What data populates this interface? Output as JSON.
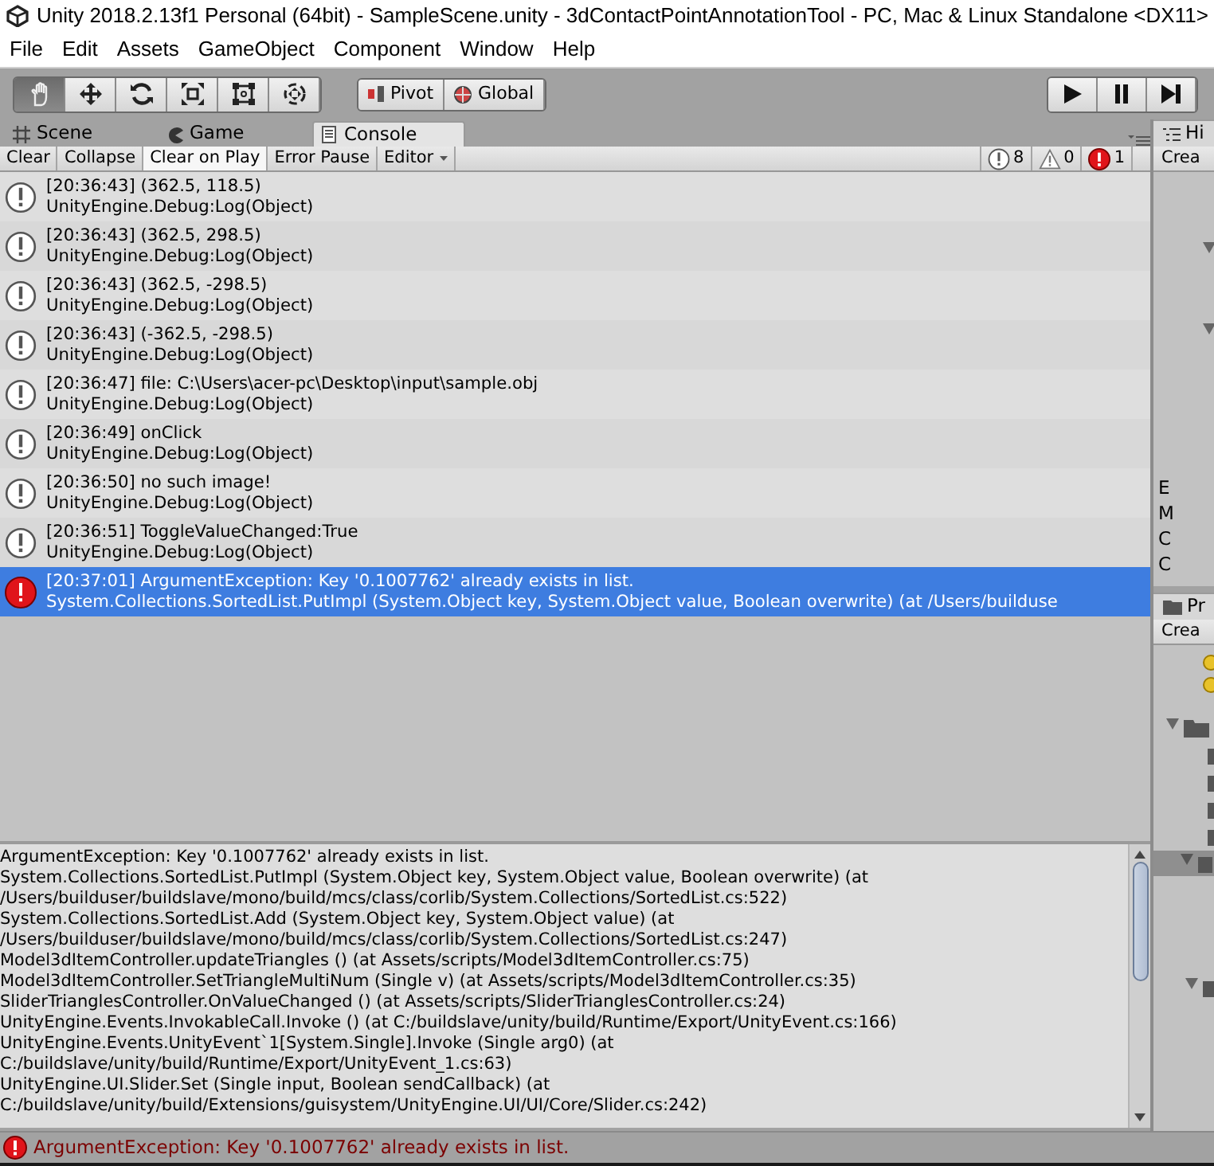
{
  "window": {
    "title": "Unity 2018.2.13f1 Personal (64bit) - SampleScene.unity - 3dContactPointAnnotationTool - PC, Mac & Linux Standalone <DX11>"
  },
  "menu": [
    "File",
    "Edit",
    "Assets",
    "GameObject",
    "Component",
    "Window",
    "Help"
  ],
  "tools": [
    {
      "kind": "hand",
      "selected": true
    },
    {
      "kind": "move",
      "selected": false
    },
    {
      "kind": "rotate",
      "selected": false
    },
    {
      "kind": "scale",
      "selected": false
    },
    {
      "kind": "rect",
      "selected": false
    },
    {
      "kind": "transform",
      "selected": false
    }
  ],
  "handle_buttons": [
    {
      "kind": "pivot",
      "label": "Pivot"
    },
    {
      "kind": "global",
      "label": "Global"
    }
  ],
  "playback": [
    {
      "kind": "play"
    },
    {
      "kind": "pause"
    },
    {
      "kind": "step"
    }
  ],
  "tabs": [
    {
      "kind": "scene",
      "label": "Scene",
      "selected": false
    },
    {
      "kind": "game",
      "label": "Game",
      "selected": false
    },
    {
      "kind": "console",
      "label": "Console",
      "selected": true
    }
  ],
  "console_toolbar": {
    "buttons": [
      {
        "label": "Clear",
        "on": false
      },
      {
        "label": "Collapse",
        "on": false
      },
      {
        "label": "Clear on Play",
        "on": true
      },
      {
        "label": "Error Pause",
        "on": false
      }
    ],
    "dropdown": "Editor",
    "counts": [
      {
        "kind": "info",
        "count": "8"
      },
      {
        "kind": "warning",
        "count": "0"
      },
      {
        "kind": "error",
        "count": "1"
      }
    ]
  },
  "logs": [
    {
      "kind": "info",
      "message": "[20:36:43] (362.5, 118.5)",
      "source": "UnityEngine.Debug:Log(Object)",
      "selected": false
    },
    {
      "kind": "info",
      "message": "[20:36:43] (362.5, 298.5)",
      "source": "UnityEngine.Debug:Log(Object)",
      "selected": false
    },
    {
      "kind": "info",
      "message": "[20:36:43] (362.5, -298.5)",
      "source": "UnityEngine.Debug:Log(Object)",
      "selected": false
    },
    {
      "kind": "info",
      "message": "[20:36:43] (-362.5, -298.5)",
      "source": "UnityEngine.Debug:Log(Object)",
      "selected": false
    },
    {
      "kind": "info",
      "message": "[20:36:47] file: C:\\Users\\acer-pc\\Desktop\\input\\sample.obj",
      "source": "UnityEngine.Debug:Log(Object)",
      "selected": false
    },
    {
      "kind": "info",
      "message": "[20:36:49] onClick",
      "source": "UnityEngine.Debug:Log(Object)",
      "selected": false
    },
    {
      "kind": "info",
      "message": "[20:36:50] no such image!",
      "source": "UnityEngine.Debug:Log(Object)",
      "selected": false
    },
    {
      "kind": "info",
      "message": "[20:36:51] ToggleValueChanged:True",
      "source": "UnityEngine.Debug:Log(Object)",
      "selected": false
    },
    {
      "kind": "error",
      "message": "[20:37:01] ArgumentException: Key '0.1007762' already exists in list.",
      "source": "System.Collections.SortedList.PutImpl (System.Object key, System.Object value, Boolean overwrite) (at /Users/builduse",
      "selected": true
    }
  ],
  "detail": [
    "ArgumentException: Key '0.1007762' already exists in list.",
    "System.Collections.SortedList.PutImpl (System.Object key, System.Object value, Boolean overwrite) (at",
    "/Users/builduser/buildslave/mono/build/mcs/class/corlib/System.Collections/SortedList.cs:522)",
    "System.Collections.SortedList.Add (System.Object key, System.Object value) (at",
    "/Users/builduser/buildslave/mono/build/mcs/class/corlib/System.Collections/SortedList.cs:247)",
    "Model3dItemController.updateTriangles () (at Assets/scripts/Model3dItemController.cs:75)",
    "Model3dItemController.SetTriangleMultiNum (Single v) (at Assets/scripts/Model3dItemController.cs:35)",
    "SliderTrianglesController.OnValueChanged () (at Assets/scripts/SliderTrianglesController.cs:24)",
    "UnityEngine.Events.InvokableCall.Invoke () (at C:/buildslave/unity/build/Runtime/Export/UnityEvent.cs:166)",
    "UnityEngine.Events.UnityEvent`1[System.Single].Invoke (Single arg0) (at",
    "C:/buildslave/unity/build/Runtime/Export/UnityEvent_1.cs:63)",
    "UnityEngine.UI.Slider.Set (Single input, Boolean sendCallback) (at",
    "C:/buildslave/unity/build/Extensions/guisystem/UnityEngine.UI/UI/Core/Slider.cs:242)"
  ],
  "hierarchy": {
    "tab": "Hi",
    "create": "Crea",
    "items": [
      "E",
      "M",
      "C",
      "C"
    ]
  },
  "project": {
    "tab": "Pr",
    "create": "Crea"
  },
  "status_bar": {
    "kind": "error",
    "message": "ArgumentException: Key '0.1007762' already exists in list."
  }
}
